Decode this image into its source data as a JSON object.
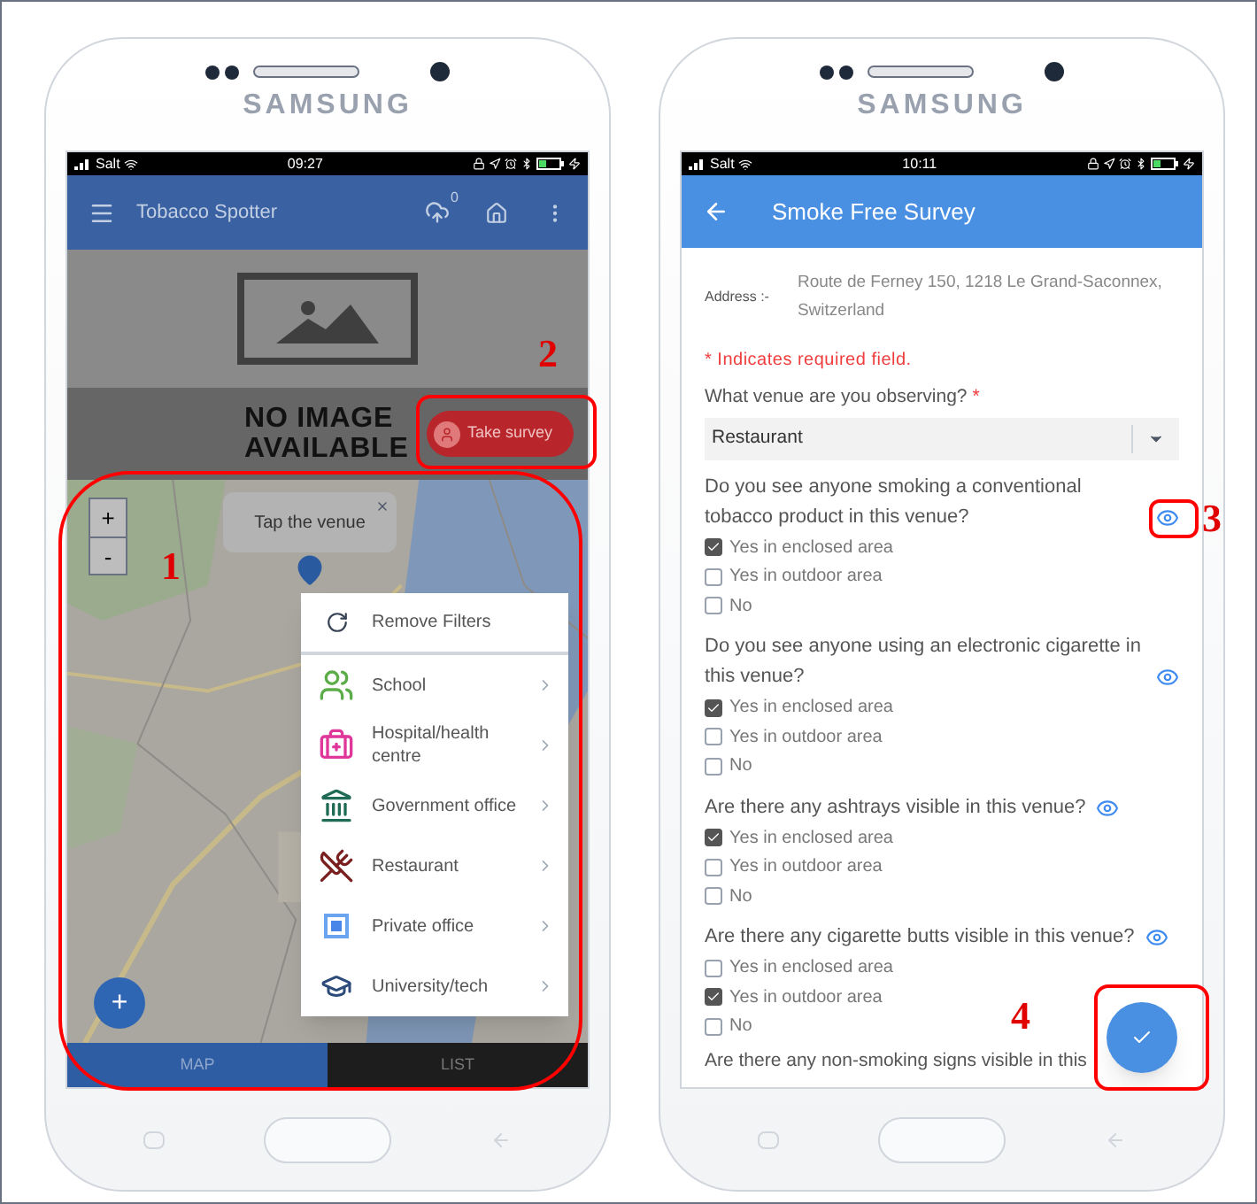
{
  "left_phone": {
    "brand": "SAMSUNG",
    "status_bar": {
      "carrier": "Salt",
      "time": "09:27"
    },
    "app_bar": {
      "title": "Tobacco Spotter",
      "sync_count": "0"
    },
    "venue_image": {
      "lines": [
        "NO IMAGE",
        "AVAILABLE"
      ]
    },
    "take_survey_button": "Take survey",
    "map": {
      "zoom_in": "+",
      "zoom_out": "-",
      "tooltip": "Tap the venue",
      "add_button": "+"
    },
    "filter_menu": [
      {
        "kind": "reset",
        "label": "Remove Filters"
      },
      {
        "kind": "school",
        "label": "School"
      },
      {
        "kind": "hospital",
        "label": "Hospital/health centre"
      },
      {
        "kind": "government",
        "label": "Government office"
      },
      {
        "kind": "restaurant",
        "label": "Restaurant"
      },
      {
        "kind": "office",
        "label": "Private office"
      },
      {
        "kind": "university",
        "label": "University/tech"
      }
    ],
    "tabs": [
      {
        "label": "MAP",
        "selected": true
      },
      {
        "label": "LIST",
        "selected": false
      }
    ]
  },
  "right_phone": {
    "brand": "SAMSUNG",
    "status_bar": {
      "carrier": "Salt",
      "time": "10:11"
    },
    "app_bar": {
      "title": "Smoke Free Survey"
    },
    "address_label": "Address :-",
    "address": "Route de Ferney 150, 1218 Le Grand-Saconnex, Switzerland",
    "required_note": "* Indicates required field.",
    "venue_question": {
      "text": "What venue are you observing?",
      "required_mark": "*"
    },
    "venue_select": "Restaurant",
    "questions": [
      {
        "text": "Do you see anyone smoking a conventional tobacco product in this venue?",
        "options": [
          {
            "label": "Yes in enclosed area",
            "checked": true
          },
          {
            "label": "Yes in outdoor area",
            "checked": false
          },
          {
            "label": "No",
            "checked": false
          }
        ]
      },
      {
        "text": "Do you see anyone using an electronic cigarette in this venue?",
        "options": [
          {
            "label": "Yes in enclosed area",
            "checked": true
          },
          {
            "label": "Yes in outdoor area",
            "checked": false
          },
          {
            "label": "No",
            "checked": false
          }
        ]
      },
      {
        "text": "Are there any ashtrays visible in this venue?",
        "options": [
          {
            "label": "Yes in enclosed area",
            "checked": true
          },
          {
            "label": "Yes in outdoor area",
            "checked": false
          },
          {
            "label": "No",
            "checked": false
          }
        ]
      },
      {
        "text": "Are there any cigarette butts visible in this venue?",
        "options": [
          {
            "label": "Yes in enclosed area",
            "checked": false
          },
          {
            "label": "Yes in outdoor area",
            "checked": true
          },
          {
            "label": "No",
            "checked": false
          }
        ]
      }
    ],
    "next_question": "Are there any non-smoking signs visible in this"
  },
  "annotations": [
    {
      "label": "1"
    },
    {
      "label": "2"
    },
    {
      "label": "3"
    },
    {
      "label": "4"
    }
  ]
}
